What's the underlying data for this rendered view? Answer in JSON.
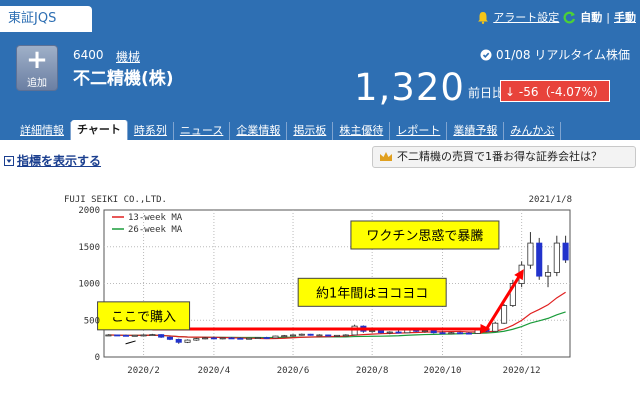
{
  "exchange_tab": "東証JQS",
  "top_links": {
    "alert": "アラート設定",
    "auto": "自動",
    "sep": "|",
    "manual": "手動"
  },
  "stock": {
    "add_label": "追加",
    "code": "6400",
    "sector": "機械",
    "name": "不二精機(株)",
    "date_time": "01/08 リアルタイム株価",
    "price": "1,320",
    "prev_label": "前日比",
    "change": "↓ -56（-4.07%）"
  },
  "tabs": [
    "詳細情報",
    "チャート",
    "時系列",
    "ニュース",
    "企業情報",
    "掲示板",
    "株主優待",
    "レポート",
    "業績予報",
    "みんかぶ"
  ],
  "active_tab": 1,
  "indicator_label": "指標を表示する",
  "promo_text": "不二精機の売買で1番お得な証券会社は？",
  "colors": {
    "header_blue": "#2e6fb3",
    "down_red": "#e8433b",
    "up_candle": "#ffffff",
    "down_candle": "#2233cc",
    "ma13": "#e02020",
    "ma26": "#1a9c3a",
    "annot_yellow": "#ffff00",
    "arrow_red": "#ff0000"
  },
  "chart_data": {
    "type": "candlestick",
    "title": "FUJI SEIKI CO.,LTD.",
    "date_label": "2021/1/8",
    "ylim": [
      0,
      2000
    ],
    "yticks": [
      "0",
      "500",
      "1000",
      "1500",
      "2000"
    ],
    "xticks": [
      {
        "label": "2020/2",
        "week": 4
      },
      {
        "label": "2020/4",
        "week": 12
      },
      {
        "label": "2020/6",
        "week": 21
      },
      {
        "label": "2020/8",
        "week": 30
      },
      {
        "label": "2020/10",
        "week": 38
      },
      {
        "label": "2020/12",
        "week": 47
      }
    ],
    "legend": [
      {
        "name": "13-week MA",
        "color": "#e02020"
      },
      {
        "name": "26-week MA",
        "color": "#1a9c3a"
      }
    ],
    "weeks": 53,
    "candles": [
      [
        0,
        300,
        310,
        290,
        300
      ],
      [
        1,
        300,
        305,
        290,
        295
      ],
      [
        2,
        295,
        305,
        285,
        290
      ],
      [
        3,
        290,
        300,
        280,
        295
      ],
      [
        4,
        295,
        310,
        285,
        300
      ],
      [
        5,
        300,
        315,
        290,
        305
      ],
      [
        6,
        305,
        310,
        260,
        270
      ],
      [
        7,
        270,
        280,
        230,
        240
      ],
      [
        8,
        240,
        250,
        180,
        200
      ],
      [
        9,
        200,
        240,
        190,
        230
      ],
      [
        10,
        230,
        260,
        220,
        250
      ],
      [
        11,
        250,
        270,
        240,
        260
      ],
      [
        12,
        260,
        275,
        245,
        250
      ],
      [
        13,
        250,
        265,
        240,
        260
      ],
      [
        14,
        260,
        270,
        245,
        255
      ],
      [
        15,
        255,
        265,
        245,
        250
      ],
      [
        16,
        250,
        260,
        240,
        255
      ],
      [
        17,
        255,
        270,
        250,
        265
      ],
      [
        18,
        265,
        275,
        255,
        260
      ],
      [
        19,
        260,
        290,
        255,
        285
      ],
      [
        20,
        285,
        300,
        275,
        290
      ],
      [
        21,
        290,
        310,
        280,
        300
      ],
      [
        22,
        300,
        320,
        290,
        310
      ],
      [
        23,
        310,
        315,
        290,
        295
      ],
      [
        24,
        295,
        310,
        285,
        300
      ],
      [
        25,
        300,
        305,
        280,
        285
      ],
      [
        26,
        285,
        300,
        275,
        295
      ],
      [
        27,
        295,
        310,
        285,
        300
      ],
      [
        28,
        300,
        440,
        295,
        420
      ],
      [
        29,
        420,
        430,
        330,
        350
      ],
      [
        30,
        350,
        380,
        330,
        360
      ],
      [
        31,
        360,
        370,
        320,
        330
      ],
      [
        32,
        330,
        350,
        310,
        340
      ],
      [
        33,
        340,
        360,
        320,
        330
      ],
      [
        34,
        330,
        400,
        325,
        380
      ],
      [
        35,
        380,
        390,
        340,
        350
      ],
      [
        36,
        350,
        370,
        330,
        360
      ],
      [
        37,
        360,
        365,
        320,
        330
      ],
      [
        38,
        330,
        350,
        310,
        320
      ],
      [
        39,
        320,
        340,
        310,
        330
      ],
      [
        40,
        330,
        345,
        315,
        325
      ],
      [
        41,
        325,
        340,
        310,
        320
      ],
      [
        42,
        320,
        400,
        315,
        380
      ],
      [
        43,
        380,
        400,
        340,
        350
      ],
      [
        44,
        350,
        480,
        345,
        460
      ],
      [
        45,
        460,
        720,
        450,
        700
      ],
      [
        46,
        700,
        1050,
        680,
        1000
      ],
      [
        47,
        1000,
        1300,
        950,
        1250
      ],
      [
        48,
        1250,
        1700,
        1200,
        1550
      ],
      [
        49,
        1550,
        1620,
        1050,
        1100
      ],
      [
        50,
        1100,
        1250,
        950,
        1150
      ],
      [
        51,
        1150,
        1650,
        1100,
        1550
      ],
      [
        52,
        1550,
        1650,
        1280,
        1320
      ]
    ],
    "annotations": [
      {
        "text": "ここで購入",
        "week": 4,
        "value": 560
      },
      {
        "text": "約1年間はヨコヨコ",
        "week": 30,
        "value": 880
      },
      {
        "text": "ワクチン思惑で暴騰",
        "week": 36,
        "value": 1660
      }
    ]
  }
}
